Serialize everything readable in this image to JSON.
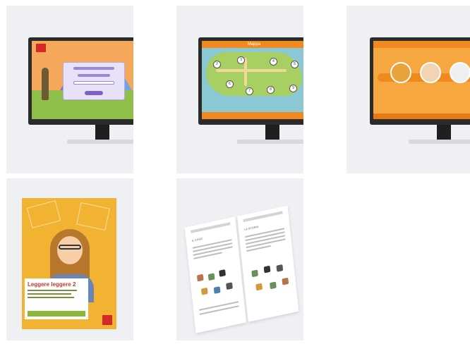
{
  "gallery": {
    "tiles": [
      {
        "type": "monitor",
        "screen": "login"
      },
      {
        "type": "monitor",
        "screen": "map",
        "header_title": "Mappa",
        "nodes": [
          "2",
          "3",
          "4",
          "5",
          "6",
          "7",
          "8",
          "9",
          "10"
        ]
      },
      {
        "type": "monitor",
        "screen": "characters"
      },
      {
        "type": "book-cover",
        "title": "Leggere leggere 2"
      },
      {
        "type": "open-workbook",
        "left_heading": "IL CASO",
        "right_heading": "LA STORIA"
      }
    ]
  },
  "colors": {
    "tile_bg": "#eef0f4",
    "accent_orange": "#f08a1e",
    "book_yellow": "#f2b333",
    "brand_red": "#d62828"
  }
}
